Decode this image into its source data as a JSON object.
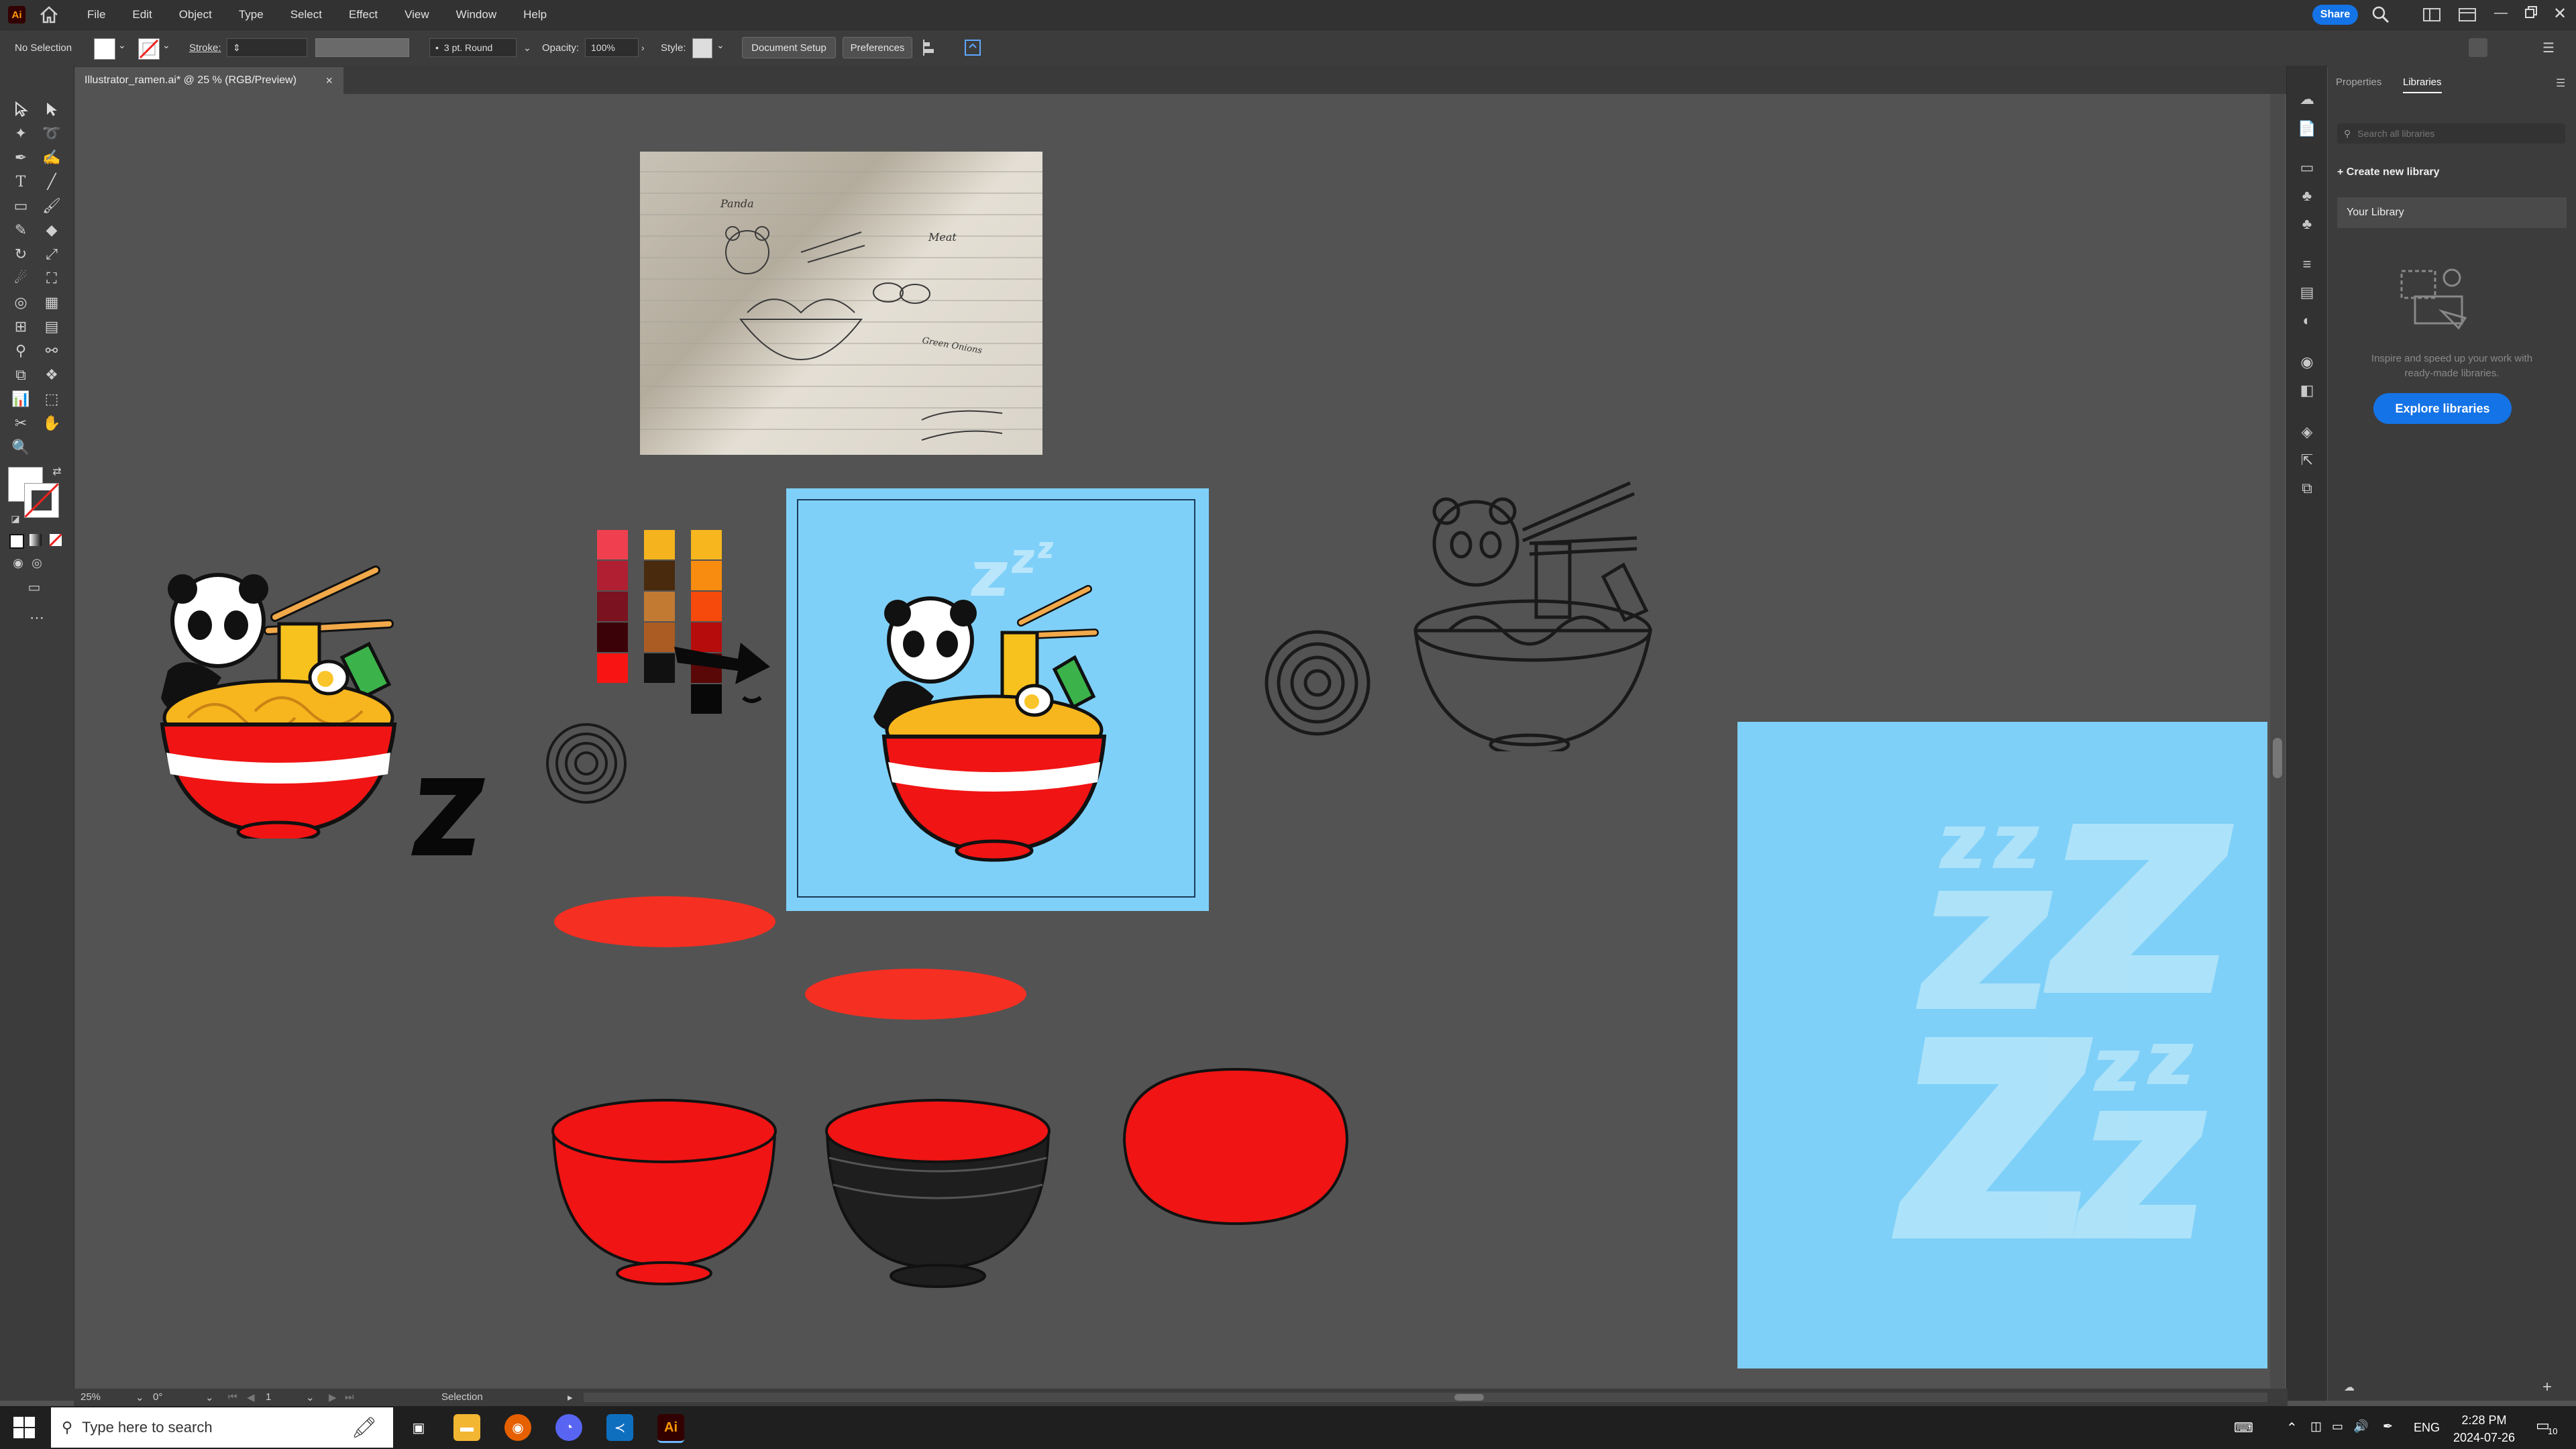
{
  "app": {
    "icon_label": "Ai",
    "document_tab": "Illustrator_ramen.ai* @ 25 % (RGB/Preview)"
  },
  "menu": [
    "File",
    "Edit",
    "Object",
    "Type",
    "Select",
    "Effect",
    "View",
    "Window",
    "Help"
  ],
  "share_label": "Share",
  "control_bar": {
    "selection": "No Selection",
    "stroke_label": "Stroke:",
    "brush": "3 pt. Round",
    "opacity_label": "Opacity:",
    "opacity_value": "100%",
    "style_label": "Style:",
    "document_setup": "Document Setup",
    "preferences": "Preferences"
  },
  "libraries_panel": {
    "tabs": [
      "Properties",
      "Libraries"
    ],
    "search_placeholder": "Search all libraries",
    "create_new": "Create new library",
    "your_library": "Your Library",
    "empty_text_1": "Inspire and speed up your work with",
    "empty_text_2": "ready-made libraries.",
    "explore_button": "Explore libraries"
  },
  "status_bar": {
    "zoom": "25%",
    "rotation": "0°",
    "artboard_number": "1",
    "tool": "Selection"
  },
  "sketch_text": {
    "note1": "Panda",
    "note2": "Meat",
    "note3": "Green Onions"
  },
  "swatch_colors": {
    "col1": [
      "#f0404f",
      "#b01f32",
      "#7a1220",
      "#3b0308",
      "#f91414"
    ],
    "col2": [
      "#f5b31e",
      "#4a2a0c",
      "#c27a33",
      "#ab5c22",
      "#111111"
    ],
    "col3": [
      "#f7b61e",
      "#f88c10",
      "#f54a0c",
      "#b60c0c",
      "#5a0707",
      "#080808"
    ]
  },
  "taskbar": {
    "search_placeholder": "Type here to search",
    "language": "ENG",
    "time": "2:28 PM",
    "date": "2024-07-26",
    "notification_count": "10"
  },
  "colors": {
    "accent": "#1473e6",
    "artboard": "#7fd0f8",
    "bowl_red": "#f01414",
    "canvas": "#535353"
  }
}
